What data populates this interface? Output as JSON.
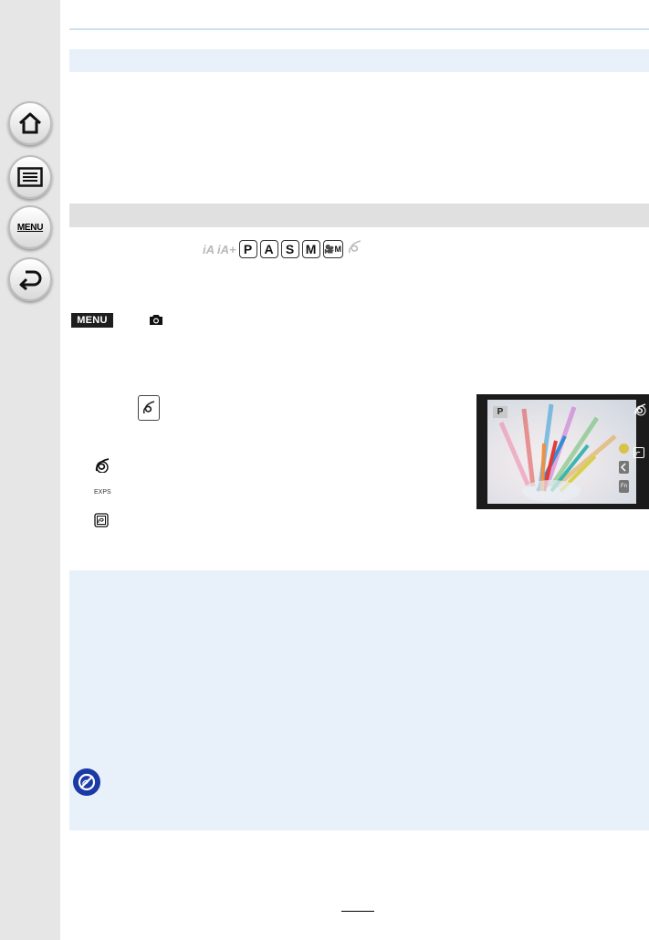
{
  "sidebar": {
    "items": [
      {
        "icon": "home-icon"
      },
      {
        "icon": "contents-list-icon"
      },
      {
        "icon": "menu-icon",
        "label": "MENU"
      },
      {
        "icon": "back-icon"
      }
    ]
  },
  "recording_modes": {
    "faint_icons": [
      "iA",
      "iA+"
    ],
    "boxed": [
      "P",
      "A",
      "S",
      "M"
    ],
    "movie_mode": "🎥M"
  },
  "menu_path": {
    "menu_label": "MENU",
    "icon": "camera-icon"
  },
  "settings": {
    "rows": [
      {
        "icon": "filter-effect-icon"
      },
      {
        "label": "EXPS"
      },
      {
        "icon": "simultaneous-record-icon"
      }
    ]
  },
  "preview": {
    "mode_label": "P"
  },
  "note": {
    "icon": "not-available-icon"
  },
  "colors": {
    "sidebar_bg": "#e6e6e6",
    "band_blue": "#e8f0fa",
    "band_gray": "#e0e0e0",
    "note_icon": "#1b3aa6"
  }
}
